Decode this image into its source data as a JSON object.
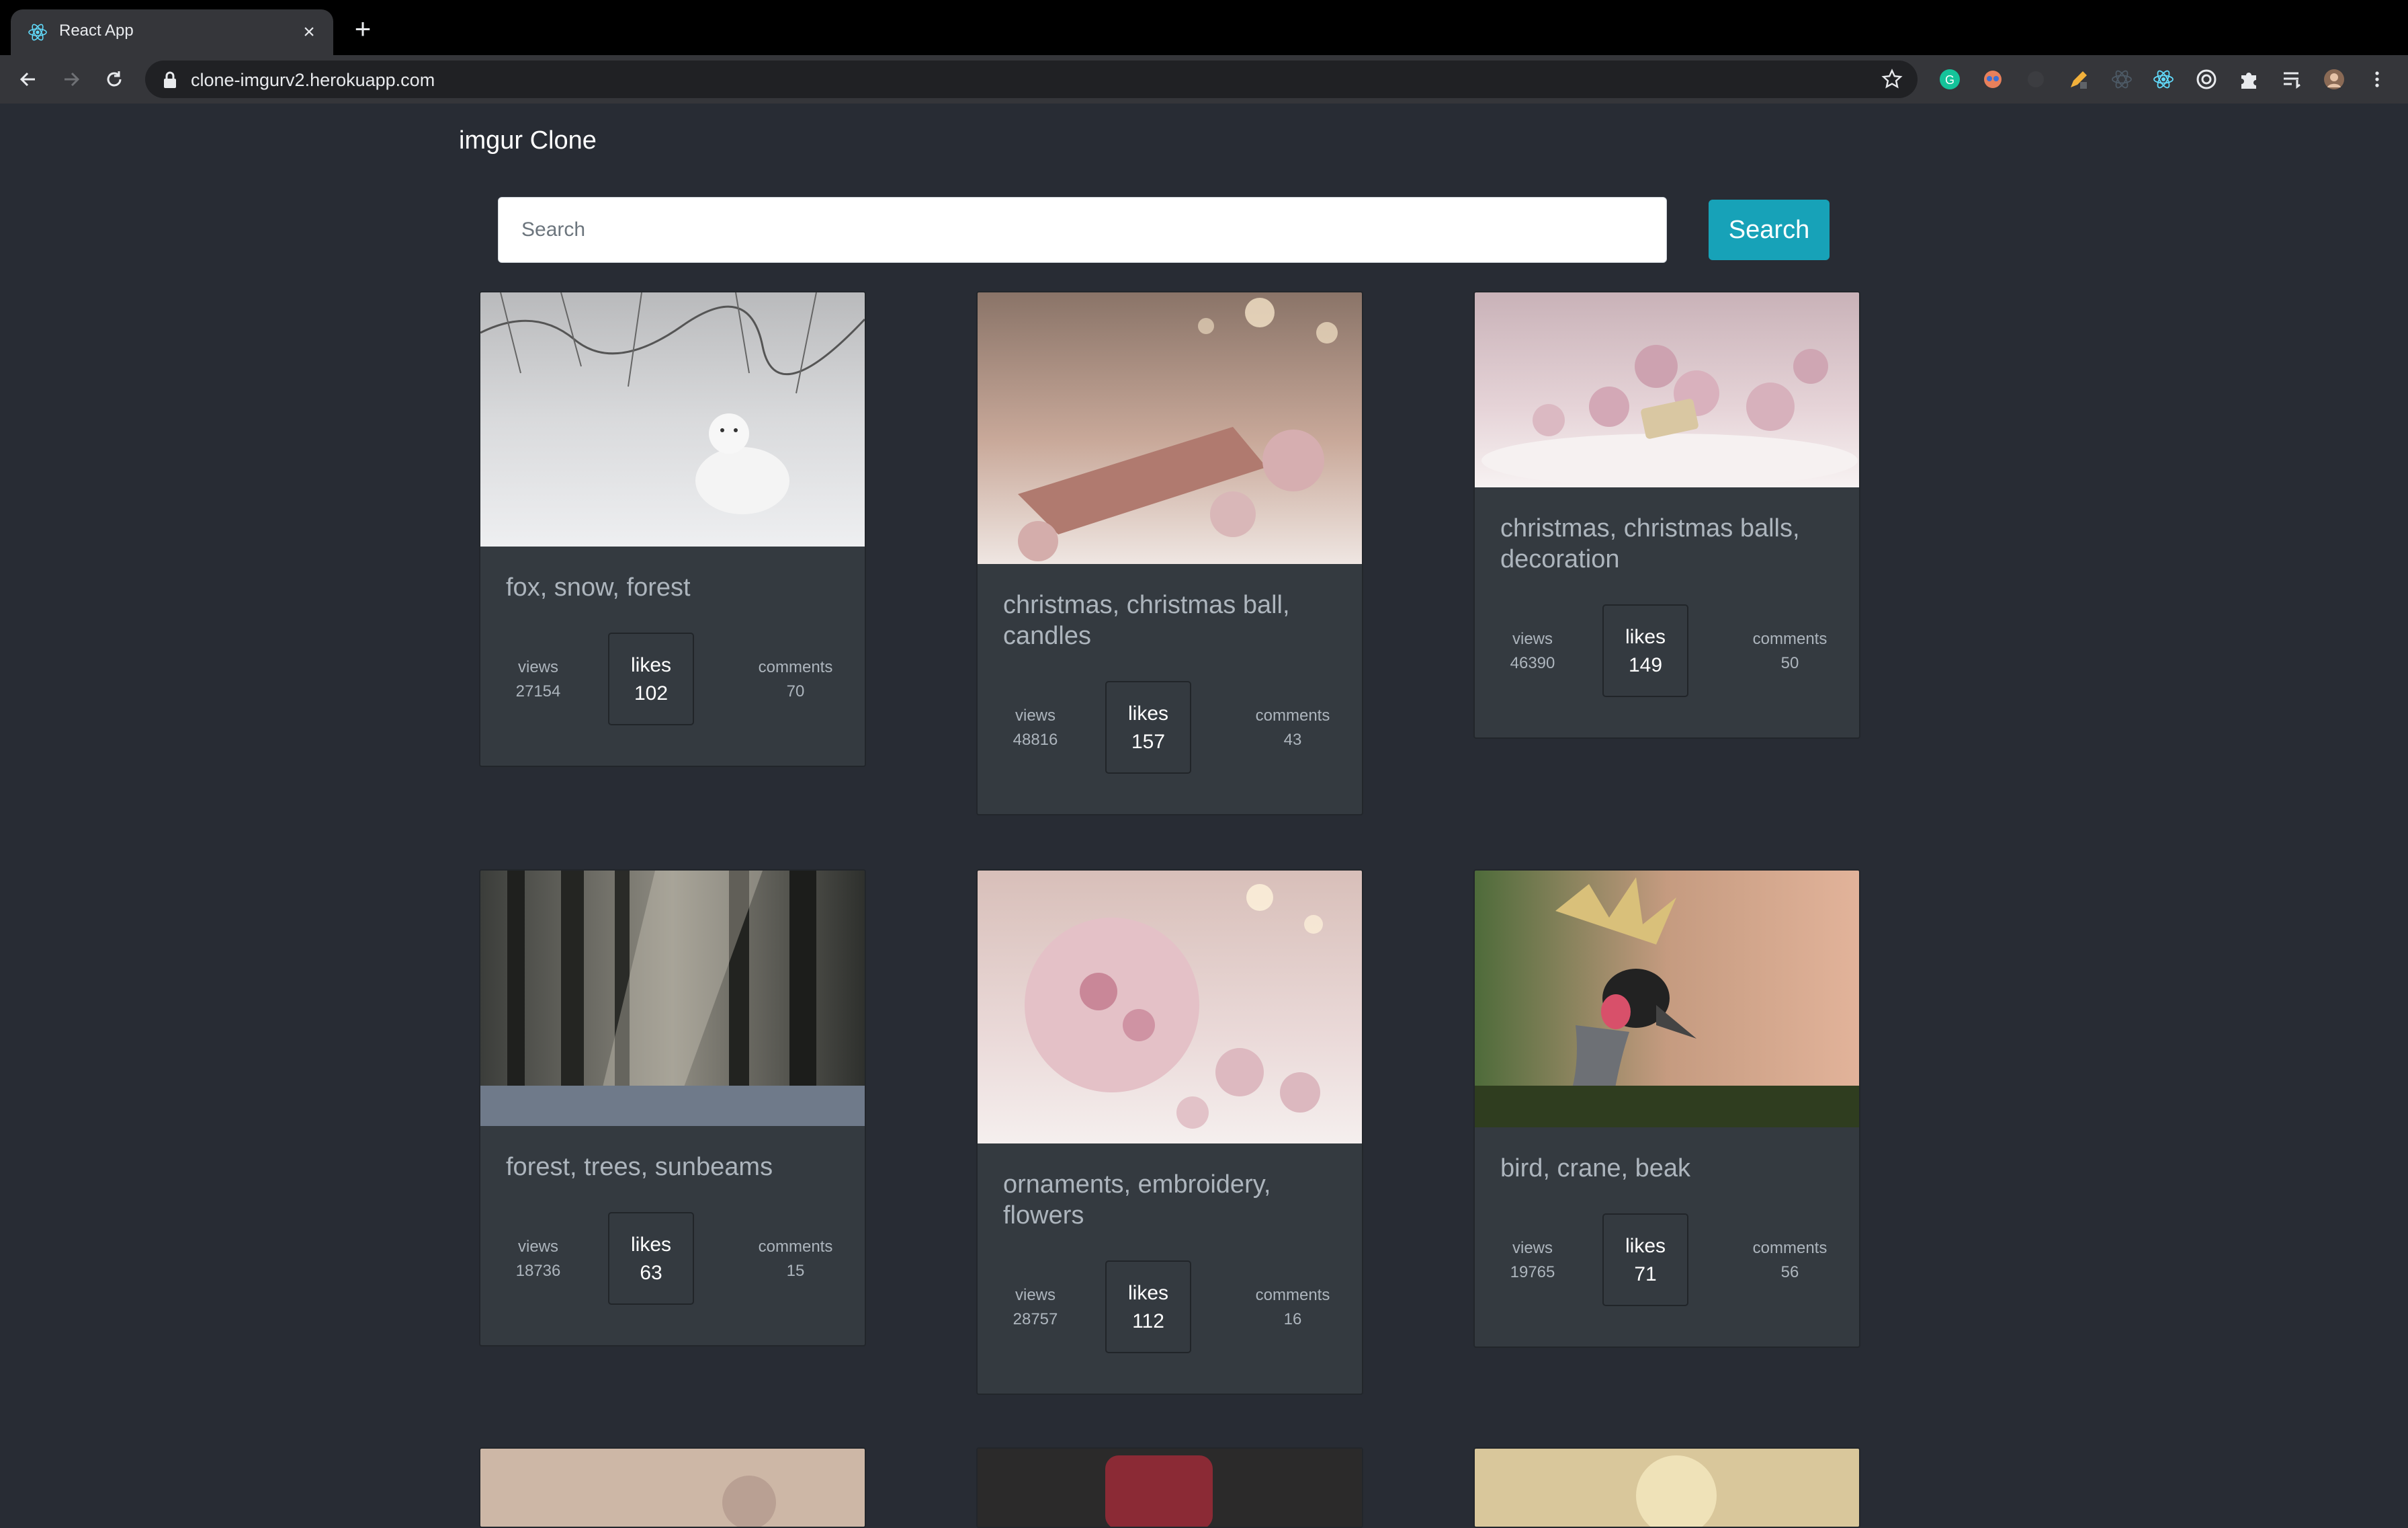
{
  "browser": {
    "tab_title": "React App",
    "url": "clone-imgurv2.herokuapp.com",
    "accent": "#35363a"
  },
  "app": {
    "title": "imgur Clone",
    "search": {
      "placeholder": "Search",
      "value": "",
      "button_label": "Search"
    },
    "colors": {
      "background": "#282c34",
      "card": "#343a40",
      "button": "#17a2b8",
      "muted_text": "#adb5bd"
    }
  },
  "cards": [
    {
      "title": "fox, snow, forest",
      "views_label": "views",
      "views": "27154",
      "likes_label": "likes",
      "likes": "102",
      "comments_label": "comments",
      "comments": "70"
    },
    {
      "title": "christmas, christmas ball, candles",
      "views_label": "views",
      "views": "48816",
      "likes_label": "likes",
      "likes": "157",
      "comments_label": "comments",
      "comments": "43"
    },
    {
      "title": "christmas, christmas balls, decoration",
      "views_label": "views",
      "views": "46390",
      "likes_label": "likes",
      "likes": "149",
      "comments_label": "comments",
      "comments": "50"
    },
    {
      "title": "forest, trees, sunbeams",
      "views_label": "views",
      "views": "18736",
      "likes_label": "likes",
      "likes": "63",
      "comments_label": "comments",
      "comments": "15"
    },
    {
      "title": "ornaments, embroidery, flowers",
      "views_label": "views",
      "views": "28757",
      "likes_label": "likes",
      "likes": "112",
      "comments_label": "comments",
      "comments": "16"
    },
    {
      "title": "bird, crane, beak",
      "views_label": "views",
      "views": "19765",
      "likes_label": "likes",
      "likes": "71",
      "comments_label": "comments",
      "comments": "56"
    }
  ]
}
